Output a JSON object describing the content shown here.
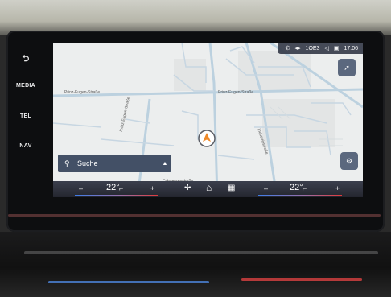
{
  "side_buttons": {
    "back_icon": "return-arrow-icon",
    "media": "MEDIA",
    "tel": "TEL",
    "nav": "NAV"
  },
  "status_bar": {
    "icons": [
      "phone-icon",
      "bluetooth-icon",
      "volume-icon",
      "screen-icon"
    ],
    "plate": "1OE3",
    "time": "17:06"
  },
  "map": {
    "street_labels": {
      "prinz_left": "Prinz-Eugen-Straße",
      "prinz_center": "Prinz-Eugen-Straße",
      "vertical_left": "Prinz-Eugen-Straße",
      "vertical_right": "Industriestraße",
      "bottom": "Estermannstraße"
    },
    "position_marker": "vehicle-position-arrow"
  },
  "search": {
    "label": "Suche",
    "icon": "search-icon",
    "caret": "▲"
  },
  "climate": {
    "left_minus": "–",
    "left_temp": "22°",
    "left_plus": "+",
    "right_minus": "–",
    "right_temp": "22°",
    "right_plus": "+",
    "fan_icon": "fan-icon",
    "home_icon": "home-icon",
    "apps_icon": "apps-grid-icon"
  },
  "colors": {
    "heat_cold": "#3f7de8",
    "heat_hot": "#e23a3a",
    "panel": "#435066"
  }
}
